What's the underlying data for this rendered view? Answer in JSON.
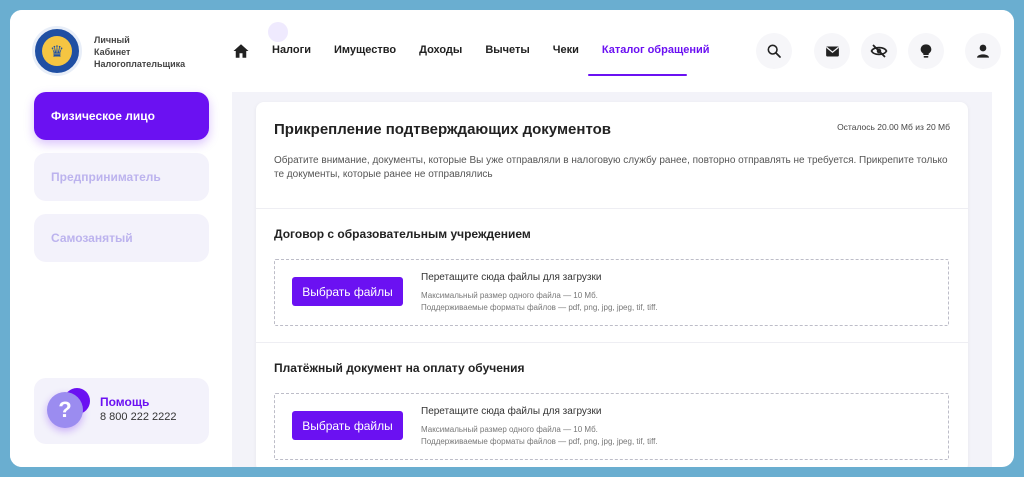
{
  "colors": {
    "accent": "#6b11f2",
    "inactive_text": "#bcb3ee",
    "frame_bg": "#6aaed0"
  },
  "logo": {
    "line1": "Личный",
    "line2": "Кабинет",
    "line3": "Налогоплательщика"
  },
  "sidebar": {
    "items": [
      {
        "label": "Физическое лицо",
        "active": true
      },
      {
        "label": "Предприниматель",
        "active": false
      },
      {
        "label": "Самозанятый",
        "active": false
      }
    ],
    "help": {
      "title": "Помощь",
      "phone": "8 800 222 2222",
      "icon": "question-icon"
    }
  },
  "nav": {
    "home_icon": "home-icon",
    "links": [
      {
        "label": "Налоги",
        "active": false
      },
      {
        "label": "Имущество",
        "active": false
      },
      {
        "label": "Доходы",
        "active": false
      },
      {
        "label": "Вычеты",
        "active": false
      },
      {
        "label": "Чеки",
        "active": false
      },
      {
        "label": "Каталог обращений",
        "active": true
      }
    ],
    "icons": [
      "search-icon",
      "mail-icon",
      "eye-off-icon",
      "lightbulb-icon",
      "user-icon"
    ]
  },
  "card": {
    "title": "Прикрепление подтверждающих документов",
    "quota": "Осталось 20.00 Мб из 20 Мб",
    "notice": "Обратите внимание, документы, которые Вы уже отправляли в налоговую службу ранее, повторно отправлять не требуется. Прикрепите только те документы, которые ранее не отправлялись",
    "sections": [
      {
        "title": "Договор с образовательным учреждением",
        "button": "Выбрать файлы",
        "drop_title": "Перетащите сюда файлы для загрузки",
        "max_size": "Максимальный размер одного файла — 10 Мб.",
        "formats": "Поддерживаемые форматы файлов — pdf, png, jpg, jpeg, tif, tiff."
      },
      {
        "title": "Платёжный документ на оплату обучения",
        "button": "Выбрать файлы",
        "drop_title": "Перетащите сюда файлы для загрузки",
        "max_size": "Максимальный размер одного файла — 10 Мб.",
        "formats": "Поддерживаемые форматы файлов — pdf, png, jpg, jpeg, tif, tiff."
      }
    ]
  }
}
